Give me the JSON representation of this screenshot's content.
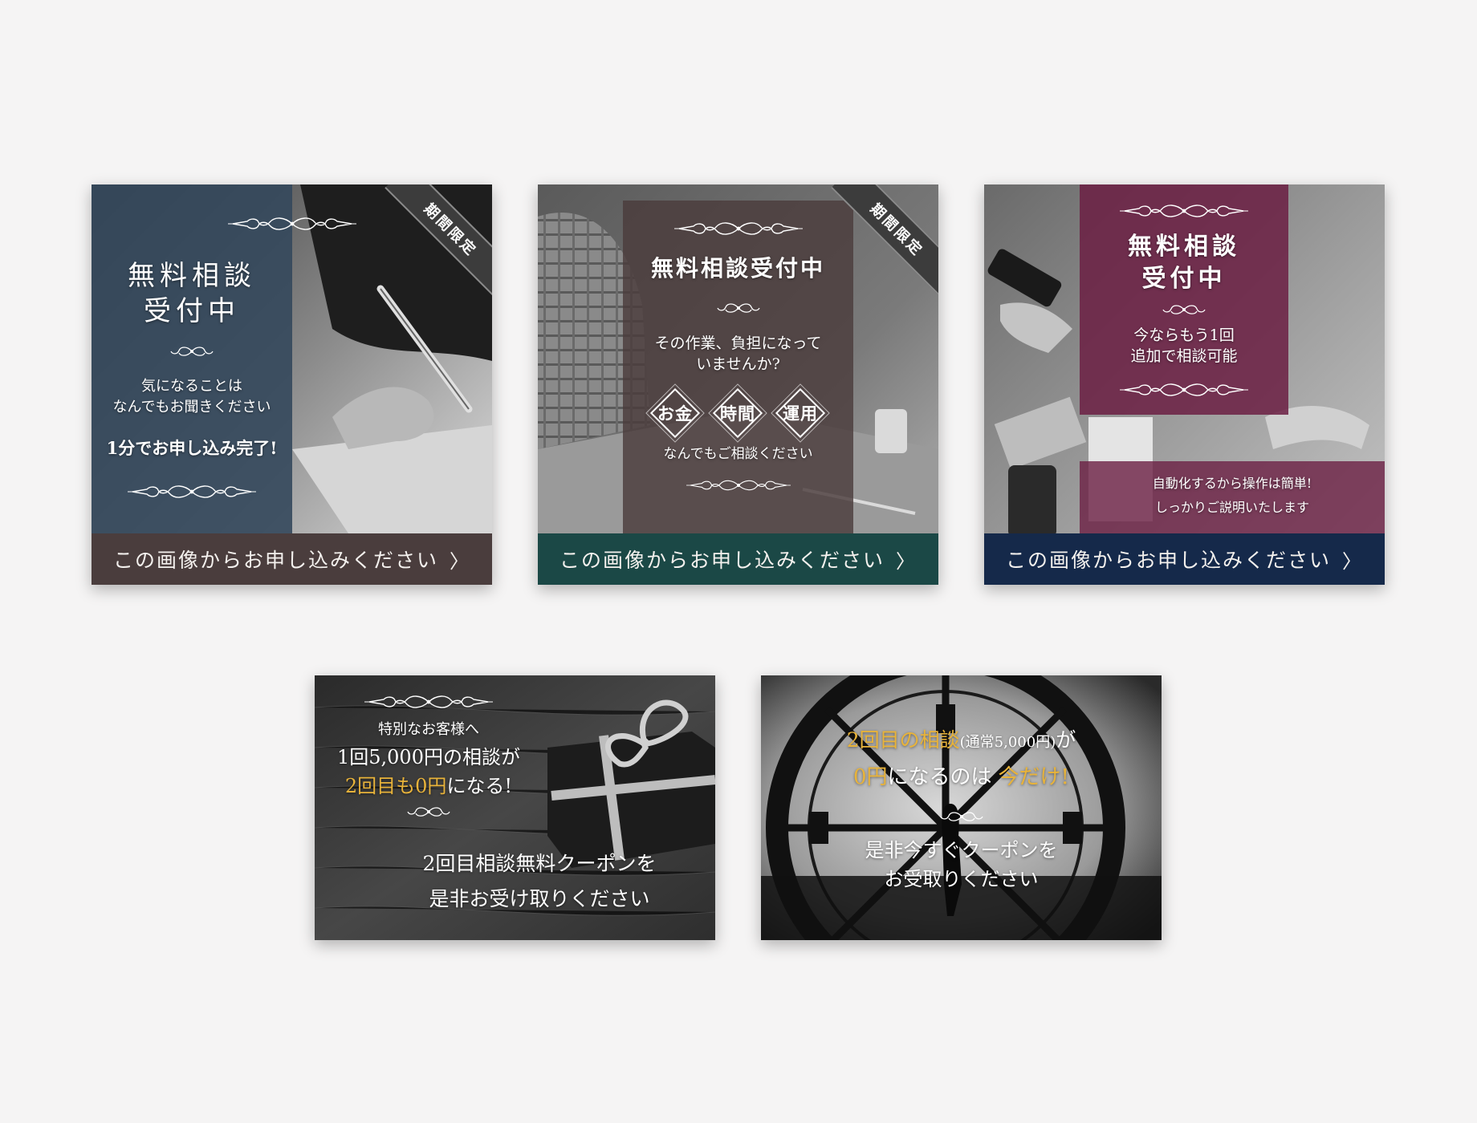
{
  "banners": {
    "b1": {
      "ribbon": "期間限定",
      "title_line1": "無料相談",
      "title_line2": "受付中",
      "sub_line1": "気になることは",
      "sub_line2": "なんでもお聞きください",
      "highlight": "1分でお申し込み完了!",
      "cta": "この画像からお申し込みください",
      "cta_color": "#4a3d3d",
      "panel_color": "#34485c"
    },
    "b2": {
      "ribbon": "期間限定",
      "title": "無料相談受付中",
      "sub_line1": "その作業、負担になって",
      "sub_line2": "いませんか?",
      "badges": [
        "お金",
        "時間",
        "運用"
      ],
      "footer_text": "なんでもご相談ください",
      "cta": "この画像からお申し込みください",
      "cta_color": "#1b4846",
      "panel_color": "#4a3c3c"
    },
    "b3": {
      "title_line1": "無料相談",
      "title_line2": "受付中",
      "sub_line1": "今ならもう1回",
      "sub_line2": "追加で相談可能",
      "bottom_line1": "自動化するから操作は簡単!",
      "bottom_line2": "しっかりご説明いたします",
      "cta": "この画像からお申し込みください",
      "cta_color": "#15294a",
      "panel_color": "#6b1f43"
    },
    "b4": {
      "line1": "特別なお客様へ",
      "line2": "1回5,000円の相談が",
      "line3_highlight": "2回目も0円",
      "line3_rest": "になる!",
      "line4": "2回目相談無料クーポンを",
      "line5": "是非お受け取りください"
    },
    "b5": {
      "line1_highlight": "2回目の相談",
      "line1_note": "(通常5,000円)",
      "line1_rest": "が",
      "line2_highlight": "0円",
      "line2_mid": "になるのは",
      "line2_highlight2": "今だけ!",
      "line3": "是非今すぐクーポンを",
      "line4": "お受取りください"
    }
  },
  "colors": {
    "page_background": "#f5f4f4",
    "gold": "#e8b33a"
  }
}
